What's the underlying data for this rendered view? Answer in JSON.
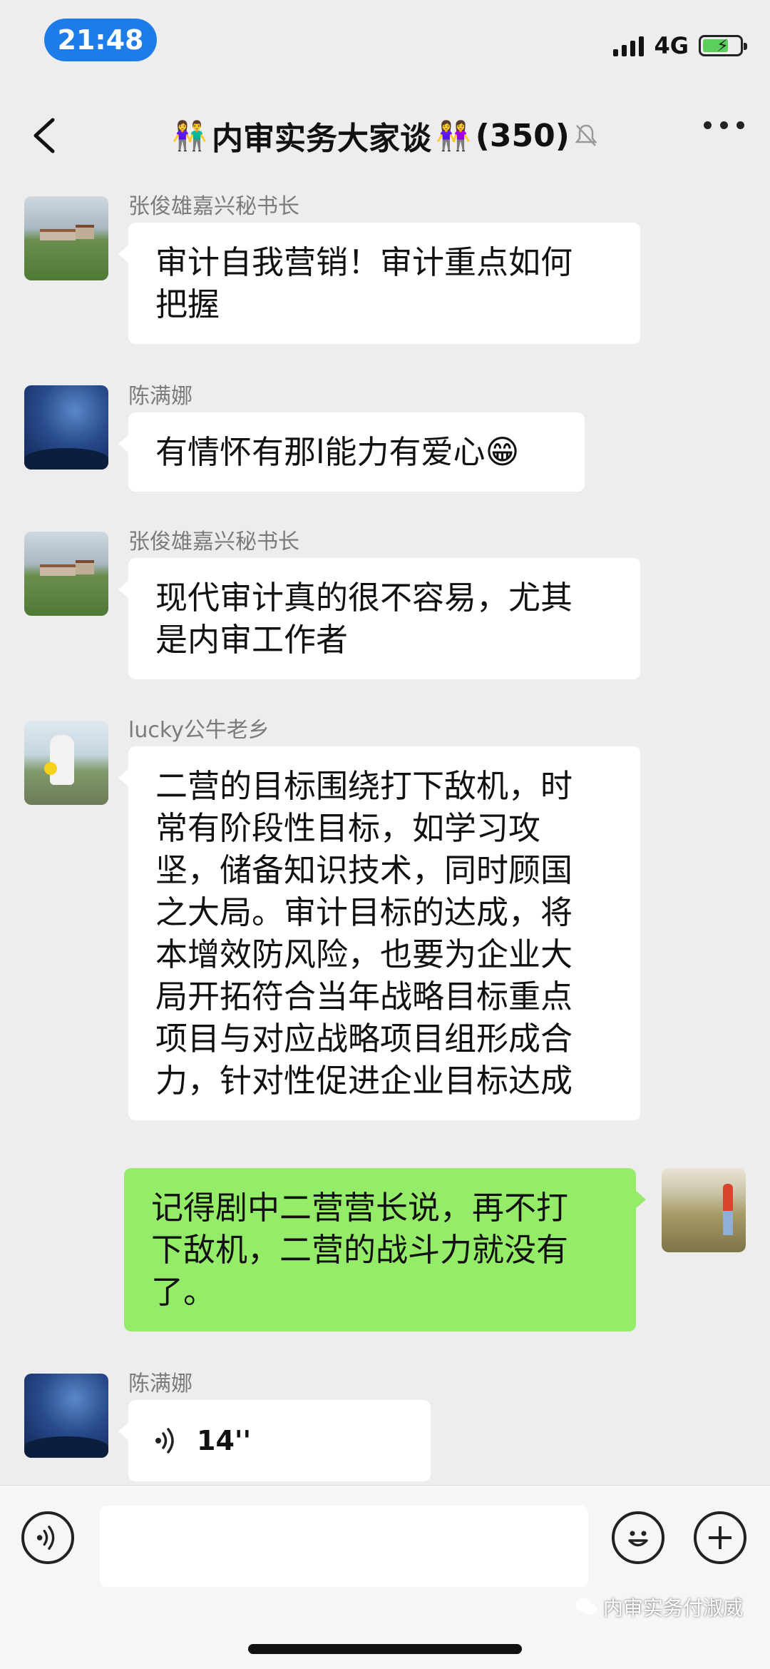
{
  "status_bar": {
    "time": "21:48",
    "network": "4G"
  },
  "header": {
    "title_prefix_icon": "👫",
    "title": "内审实务大家谈",
    "title_suffix_icon": "👭",
    "member_count": "(350)"
  },
  "messages": [
    {
      "sender": "张俊雄嘉兴秘书长",
      "text_lines": [
        "审计自我营销！审计重点如何",
        "把握"
      ],
      "avatar": "landscape-avatar"
    },
    {
      "sender": "陈满娜",
      "text": "有情怀有那l能力有爱心",
      "emoji": "😁",
      "avatar": "night-sky-avatar"
    },
    {
      "sender": "张俊雄嘉兴秘书长",
      "text_lines": [
        "现代审计真的很不容易，尤其",
        "是内审工作者"
      ],
      "avatar": "landscape-avatar"
    },
    {
      "sender": "lucky公牛老乡",
      "text_lines": [
        "二营的目标围绕打下敌机，时",
        "常有阶段性目标，如学习攻",
        "坚，储备知识技术，同时顾国",
        "之大局。审计目标的达成，将",
        "本增效防风险，也要为企业大",
        "局开拓符合当年战略目标重点",
        "项目与对应战略项目组形成合",
        "力，针对性促进企业目标达成"
      ],
      "avatar": "person-avatar"
    },
    {
      "sender": "",
      "text_lines": [
        "记得剧中二营营长说，再不打",
        "下敌机，二营的战斗力就没有",
        "了。"
      ],
      "avatar": "self-avatar",
      "own": true
    },
    {
      "sender": "陈满娜",
      "voice_duration": "14''",
      "avatar": "night-sky-avatar"
    }
  ],
  "watermark": "内审实务付淑威",
  "colors": {
    "time_pill": "#1e7ce8",
    "own_bubble": "#95ec69",
    "background": "#ededed"
  }
}
